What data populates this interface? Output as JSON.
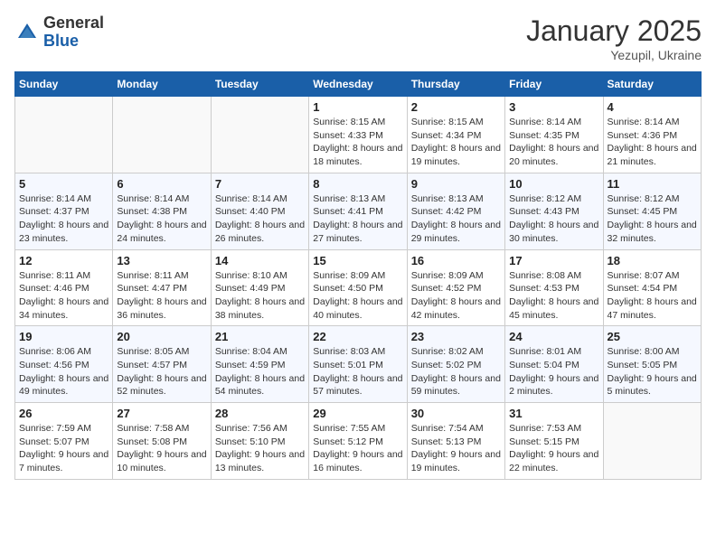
{
  "header": {
    "logo_general": "General",
    "logo_blue": "Blue",
    "month_title": "January 2025",
    "subtitle": "Yezupil, Ukraine"
  },
  "days_of_week": [
    "Sunday",
    "Monday",
    "Tuesday",
    "Wednesday",
    "Thursday",
    "Friday",
    "Saturday"
  ],
  "weeks": [
    [
      {
        "day": "",
        "sunrise": "",
        "sunset": "",
        "daylight": ""
      },
      {
        "day": "",
        "sunrise": "",
        "sunset": "",
        "daylight": ""
      },
      {
        "day": "",
        "sunrise": "",
        "sunset": "",
        "daylight": ""
      },
      {
        "day": "1",
        "sunrise": "Sunrise: 8:15 AM",
        "sunset": "Sunset: 4:33 PM",
        "daylight": "Daylight: 8 hours and 18 minutes."
      },
      {
        "day": "2",
        "sunrise": "Sunrise: 8:15 AM",
        "sunset": "Sunset: 4:34 PM",
        "daylight": "Daylight: 8 hours and 19 minutes."
      },
      {
        "day": "3",
        "sunrise": "Sunrise: 8:14 AM",
        "sunset": "Sunset: 4:35 PM",
        "daylight": "Daylight: 8 hours and 20 minutes."
      },
      {
        "day": "4",
        "sunrise": "Sunrise: 8:14 AM",
        "sunset": "Sunset: 4:36 PM",
        "daylight": "Daylight: 8 hours and 21 minutes."
      }
    ],
    [
      {
        "day": "5",
        "sunrise": "Sunrise: 8:14 AM",
        "sunset": "Sunset: 4:37 PM",
        "daylight": "Daylight: 8 hours and 23 minutes."
      },
      {
        "day": "6",
        "sunrise": "Sunrise: 8:14 AM",
        "sunset": "Sunset: 4:38 PM",
        "daylight": "Daylight: 8 hours and 24 minutes."
      },
      {
        "day": "7",
        "sunrise": "Sunrise: 8:14 AM",
        "sunset": "Sunset: 4:40 PM",
        "daylight": "Daylight: 8 hours and 26 minutes."
      },
      {
        "day": "8",
        "sunrise": "Sunrise: 8:13 AM",
        "sunset": "Sunset: 4:41 PM",
        "daylight": "Daylight: 8 hours and 27 minutes."
      },
      {
        "day": "9",
        "sunrise": "Sunrise: 8:13 AM",
        "sunset": "Sunset: 4:42 PM",
        "daylight": "Daylight: 8 hours and 29 minutes."
      },
      {
        "day": "10",
        "sunrise": "Sunrise: 8:12 AM",
        "sunset": "Sunset: 4:43 PM",
        "daylight": "Daylight: 8 hours and 30 minutes."
      },
      {
        "day": "11",
        "sunrise": "Sunrise: 8:12 AM",
        "sunset": "Sunset: 4:45 PM",
        "daylight": "Daylight: 8 hours and 32 minutes."
      }
    ],
    [
      {
        "day": "12",
        "sunrise": "Sunrise: 8:11 AM",
        "sunset": "Sunset: 4:46 PM",
        "daylight": "Daylight: 8 hours and 34 minutes."
      },
      {
        "day": "13",
        "sunrise": "Sunrise: 8:11 AM",
        "sunset": "Sunset: 4:47 PM",
        "daylight": "Daylight: 8 hours and 36 minutes."
      },
      {
        "day": "14",
        "sunrise": "Sunrise: 8:10 AM",
        "sunset": "Sunset: 4:49 PM",
        "daylight": "Daylight: 8 hours and 38 minutes."
      },
      {
        "day": "15",
        "sunrise": "Sunrise: 8:09 AM",
        "sunset": "Sunset: 4:50 PM",
        "daylight": "Daylight: 8 hours and 40 minutes."
      },
      {
        "day": "16",
        "sunrise": "Sunrise: 8:09 AM",
        "sunset": "Sunset: 4:52 PM",
        "daylight": "Daylight: 8 hours and 42 minutes."
      },
      {
        "day": "17",
        "sunrise": "Sunrise: 8:08 AM",
        "sunset": "Sunset: 4:53 PM",
        "daylight": "Daylight: 8 hours and 45 minutes."
      },
      {
        "day": "18",
        "sunrise": "Sunrise: 8:07 AM",
        "sunset": "Sunset: 4:54 PM",
        "daylight": "Daylight: 8 hours and 47 minutes."
      }
    ],
    [
      {
        "day": "19",
        "sunrise": "Sunrise: 8:06 AM",
        "sunset": "Sunset: 4:56 PM",
        "daylight": "Daylight: 8 hours and 49 minutes."
      },
      {
        "day": "20",
        "sunrise": "Sunrise: 8:05 AM",
        "sunset": "Sunset: 4:57 PM",
        "daylight": "Daylight: 8 hours and 52 minutes."
      },
      {
        "day": "21",
        "sunrise": "Sunrise: 8:04 AM",
        "sunset": "Sunset: 4:59 PM",
        "daylight": "Daylight: 8 hours and 54 minutes."
      },
      {
        "day": "22",
        "sunrise": "Sunrise: 8:03 AM",
        "sunset": "Sunset: 5:01 PM",
        "daylight": "Daylight: 8 hours and 57 minutes."
      },
      {
        "day": "23",
        "sunrise": "Sunrise: 8:02 AM",
        "sunset": "Sunset: 5:02 PM",
        "daylight": "Daylight: 8 hours and 59 minutes."
      },
      {
        "day": "24",
        "sunrise": "Sunrise: 8:01 AM",
        "sunset": "Sunset: 5:04 PM",
        "daylight": "Daylight: 9 hours and 2 minutes."
      },
      {
        "day": "25",
        "sunrise": "Sunrise: 8:00 AM",
        "sunset": "Sunset: 5:05 PM",
        "daylight": "Daylight: 9 hours and 5 minutes."
      }
    ],
    [
      {
        "day": "26",
        "sunrise": "Sunrise: 7:59 AM",
        "sunset": "Sunset: 5:07 PM",
        "daylight": "Daylight: 9 hours and 7 minutes."
      },
      {
        "day": "27",
        "sunrise": "Sunrise: 7:58 AM",
        "sunset": "Sunset: 5:08 PM",
        "daylight": "Daylight: 9 hours and 10 minutes."
      },
      {
        "day": "28",
        "sunrise": "Sunrise: 7:56 AM",
        "sunset": "Sunset: 5:10 PM",
        "daylight": "Daylight: 9 hours and 13 minutes."
      },
      {
        "day": "29",
        "sunrise": "Sunrise: 7:55 AM",
        "sunset": "Sunset: 5:12 PM",
        "daylight": "Daylight: 9 hours and 16 minutes."
      },
      {
        "day": "30",
        "sunrise": "Sunrise: 7:54 AM",
        "sunset": "Sunset: 5:13 PM",
        "daylight": "Daylight: 9 hours and 19 minutes."
      },
      {
        "day": "31",
        "sunrise": "Sunrise: 7:53 AM",
        "sunset": "Sunset: 5:15 PM",
        "daylight": "Daylight: 9 hours and 22 minutes."
      },
      {
        "day": "",
        "sunrise": "",
        "sunset": "",
        "daylight": ""
      }
    ]
  ]
}
